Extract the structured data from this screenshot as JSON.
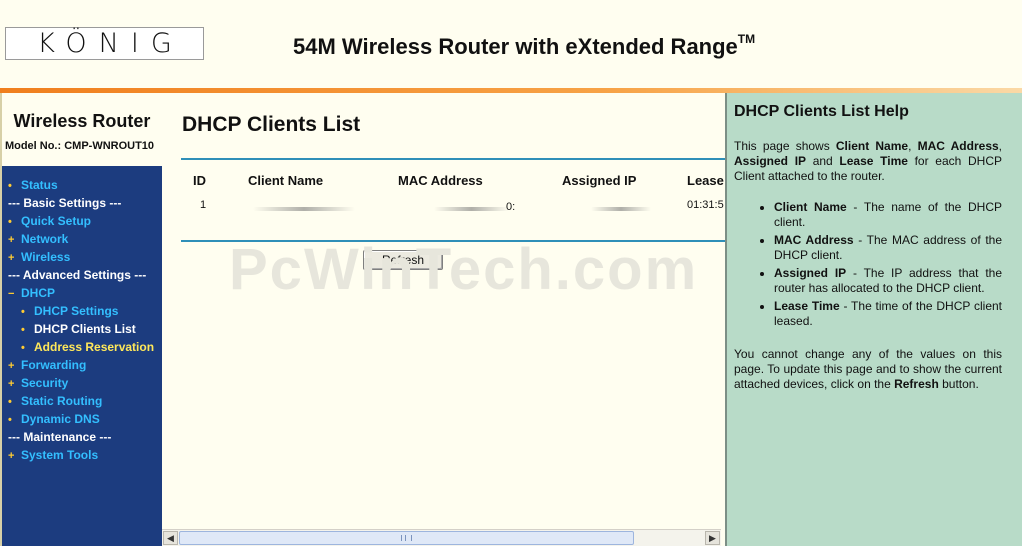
{
  "header": {
    "logo_text": "KÖNIG",
    "title": "54M Wireless Router with eXtended Range",
    "title_tm": "TM"
  },
  "sidebar": {
    "title": "Wireless Router",
    "model": "Model No.: CMP-WNROUT10",
    "items": [
      {
        "label": "Status",
        "type": "link"
      },
      {
        "label": "--- Basic Settings ---",
        "type": "section"
      },
      {
        "label": "Quick Setup",
        "type": "link"
      },
      {
        "label": "Network",
        "type": "expand"
      },
      {
        "label": "Wireless",
        "type": "expand"
      },
      {
        "label": "--- Advanced Settings ---",
        "type": "section"
      },
      {
        "label": "DHCP",
        "type": "collapse"
      },
      {
        "label": "DHCP Settings",
        "type": "sub"
      },
      {
        "label": "DHCP Clients List",
        "type": "sub-active"
      },
      {
        "label": "Address Reservation",
        "type": "sub-highlight"
      },
      {
        "label": "Forwarding",
        "type": "expand"
      },
      {
        "label": "Security",
        "type": "expand"
      },
      {
        "label": "Static Routing",
        "type": "link"
      },
      {
        "label": "Dynamic DNS",
        "type": "link"
      },
      {
        "label": "--- Maintenance ---",
        "type": "section"
      },
      {
        "label": "System Tools",
        "type": "expand"
      }
    ]
  },
  "main": {
    "page_title": "DHCP Clients List",
    "columns": [
      "ID",
      "Client Name",
      "MAC Address",
      "Assigned IP",
      "Lease"
    ],
    "rows": [
      {
        "id": "1",
        "client_name": "",
        "mac_tail": "0:",
        "assigned_ip": "",
        "lease": "01:31:5"
      }
    ],
    "refresh_label": "Refresh",
    "watermark": "PcWinTech.com"
  },
  "help": {
    "title": "DHCP Clients List Help",
    "intro_1": "This page shows ",
    "intro_b1": "Client Name",
    "intro_2": ", ",
    "intro_b2": "MAC Address",
    "intro_3": ", ",
    "intro_b3": "Assigned IP",
    "intro_4": " and ",
    "intro_b4": "Lease Time",
    "intro_5": " for each DHCP Client attached to the router.",
    "items": [
      {
        "term": "Client Name",
        "desc": " - The name of the DHCP client."
      },
      {
        "term": "MAC Address",
        "desc": " - The MAC address of the DHCP client."
      },
      {
        "term": "Assigned IP",
        "desc": " - The IP address that the router has allocated to the DHCP client."
      },
      {
        "term": "Lease Time",
        "desc": " - The time of the DHCP client leased."
      }
    ],
    "outro_1": "You cannot change any of the values on this page. To update this page and to show the current attached devices, click on the ",
    "outro_b": "Refresh",
    "outro_2": " button."
  },
  "colors": {
    "sidebar_bg": "#1c3c7f",
    "menu_link": "#33bfff",
    "help_bg": "#b8dbc8",
    "accent_stripe": "#f07f1e",
    "rule": "#2f8fb8"
  }
}
